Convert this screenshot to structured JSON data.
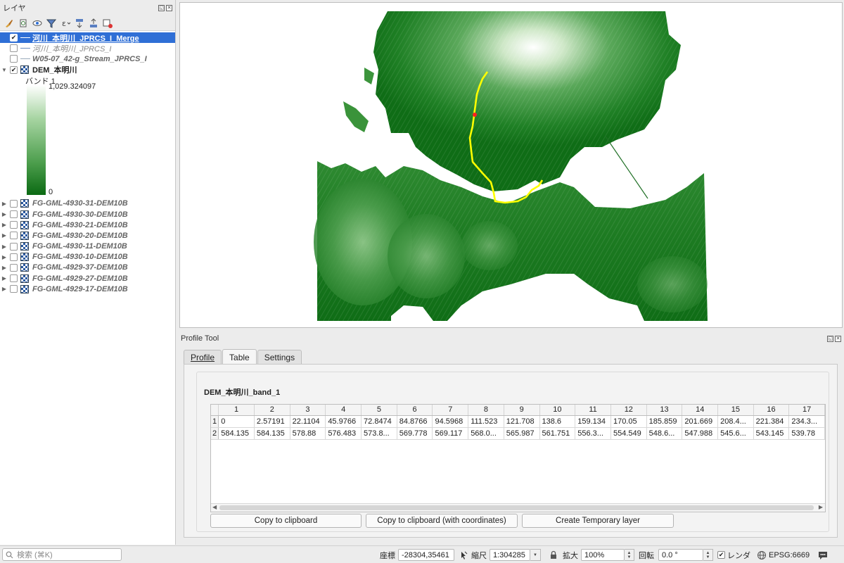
{
  "layers_panel": {
    "title": "レイヤ",
    "layers": [
      {
        "name": "河川_本明川_JPRCS_I_Merge",
        "checked": "✔",
        "selected": true
      },
      {
        "name": "河川_本明川_JPRCS_I",
        "checked": ""
      },
      {
        "name": "W05-07_42-g_Stream_JPRCS_I",
        "checked": ""
      },
      {
        "name": "DEM_本明川",
        "checked": "✔"
      }
    ],
    "legend": {
      "band": "バンド 1",
      "max": "1,029.324097",
      "min": "0"
    },
    "dem_layers": [
      "FG-GML-4930-31-DEM10B",
      "FG-GML-4930-30-DEM10B",
      "FG-GML-4930-21-DEM10B",
      "FG-GML-4930-20-DEM10B",
      "FG-GML-4930-11-DEM10B",
      "FG-GML-4930-10-DEM10B",
      "FG-GML-4929-37-DEM10B",
      "FG-GML-4929-27-DEM10B",
      "FG-GML-4929-17-DEM10B"
    ]
  },
  "profile_tool": {
    "title": "Profile Tool",
    "tabs": [
      "Profile",
      "Table",
      "Settings"
    ],
    "active_tab": "Table",
    "band_title": "DEM_本明川_band_1",
    "columns": [
      "1",
      "2",
      "3",
      "4",
      "5",
      "6",
      "7",
      "8",
      "9",
      "10",
      "11",
      "12",
      "13",
      "14",
      "15",
      "16",
      "17"
    ],
    "rows": [
      {
        "label": "1",
        "cells": [
          "0",
          "2.57191",
          "22.1104",
          "45.9766",
          "72.8474",
          "84.8766",
          "94.5968",
          "111.523",
          "121.708",
          "138.6",
          "159.134",
          "170.05",
          "185.859",
          "201.669",
          "208.4...",
          "221.384",
          "234.3..."
        ]
      },
      {
        "label": "2",
        "cells": [
          "584.135",
          "584.135",
          "578.88",
          "576.483",
          "573.8...",
          "569.778",
          "569.117",
          "568.0...",
          "565.987",
          "561.751",
          "556.3...",
          "554.549",
          "548.6...",
          "547.988",
          "545.6...",
          "543.145",
          "539.78"
        ]
      }
    ],
    "buttons": {
      "copy": "Copy to clipboard",
      "copy_coords": "Copy to clipboard (with coordinates)",
      "create_layer": "Create Temporary layer"
    }
  },
  "statusbar": {
    "search_placeholder": "検索 (⌘K)",
    "coord_label": "座標",
    "coord_value": "-28304,35461",
    "scale_label": "縮尺",
    "scale_value": "1:304285",
    "magnifier_label": "拡大",
    "magnifier_value": "100%",
    "rotation_label": "回転",
    "rotation_value": "0.0 °",
    "render_label": "レンダ",
    "crs": "EPSG:6669"
  },
  "colors": {
    "selection": "#2f6fd6",
    "dem_low": "#0b6a13",
    "dem_high": "#ffffff",
    "river": "#ffff00",
    "point": "#ff2020"
  }
}
